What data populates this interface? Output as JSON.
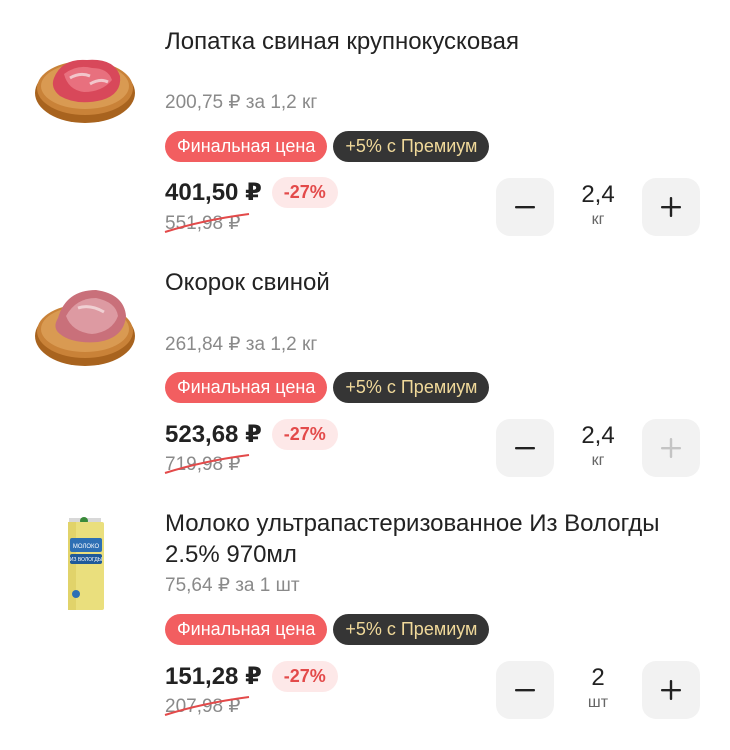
{
  "items": [
    {
      "title": "Лопатка свиная крупнокусковая",
      "unit_price": "200,75 ₽ за 1,2 кг",
      "badge_final": "Финальная цена",
      "badge_premium": "+5% с Премиум",
      "price": "401,50 ₽",
      "discount": "-27%",
      "old_price": "551,98 ₽",
      "quantity": "2,4",
      "quantity_unit": "кг",
      "plus_enabled": true,
      "image": "pork-shoulder-image"
    },
    {
      "title": "Окорок свиной",
      "unit_price": "261,84 ₽ за 1,2 кг",
      "badge_final": "Финальная цена",
      "badge_premium": "+5% с Премиум",
      "price": "523,68 ₽",
      "discount": "-27%",
      "old_price": "719,98 ₽",
      "quantity": "2,4",
      "quantity_unit": "кг",
      "plus_enabled": false,
      "image": "pork-ham-image"
    },
    {
      "title": "Молоко ультрапастеризованное Из Вологды 2.5% 970мл",
      "unit_price": "75,64 ₽ за 1 шт",
      "badge_final": "Финальная цена",
      "badge_premium": "+5% с Премиум",
      "price": "151,28 ₽",
      "discount": "-27%",
      "old_price": "207,98 ₽",
      "quantity": "2",
      "quantity_unit": "шт",
      "plus_enabled": true,
      "image": "milk-carton-image",
      "image_label": "МОЛОКО ИЗ ВОЛОГДЫ"
    }
  ],
  "colors": {
    "final_badge": "#f25e60",
    "premium_badge_bg": "#353535",
    "premium_badge_text": "#f0d99a",
    "discount_text": "#e34a4a",
    "discount_bg": "#fde8e8",
    "strike": "#e34a4a"
  },
  "icons": {
    "minus": "minus-icon",
    "plus": "plus-icon"
  }
}
